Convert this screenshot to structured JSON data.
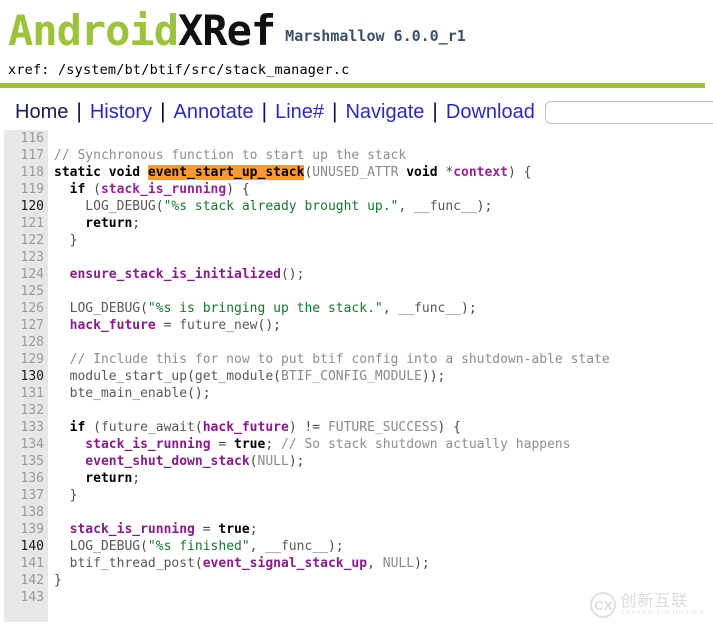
{
  "header": {
    "logo_android": "Android",
    "logo_xref": "XRef",
    "version": "Marshmallow 6.0.0_r1"
  },
  "breadcrumb": {
    "label": "xref:",
    "path": "/system/bt/btif/src/stack_manager.c",
    "full": "xref: /system/bt/btif/src/stack_manager.c"
  },
  "nav": {
    "items": [
      {
        "label": "Home",
        "current": true
      },
      {
        "label": "History",
        "current": false
      },
      {
        "label": "Annotate",
        "current": false
      },
      {
        "label": "Line#",
        "current": false
      },
      {
        "label": "Navigate",
        "current": false
      },
      {
        "label": "Download",
        "current": false
      }
    ],
    "separator": "|",
    "search": {
      "value": "",
      "placeholder": ""
    }
  },
  "colors": {
    "brand_green": "#9dc23c",
    "divider_green": "#9fc23c",
    "link_blue": "#2b2bbb",
    "highlight_orange": "#ff9933",
    "gutter_gray": "#e7e7e7",
    "string_green": "#15772f",
    "identifier_purple": "#8b1a8b",
    "comment_gray": "#8e8e8e",
    "version_blue": "#3b5068"
  },
  "code": {
    "highlighted_symbol": "event_start_up_stack",
    "first_line": 116,
    "last_line": 143,
    "lines": [
      {
        "n": "116",
        "tokens": []
      },
      {
        "n": "117",
        "tokens": [
          {
            "t": "comment",
            "s": "// Synchronous function to start up the stack"
          }
        ]
      },
      {
        "n": "118",
        "tokens": [
          {
            "t": "kw",
            "s": "static void "
          },
          {
            "t": "hl",
            "s": "event_start_up_stack"
          },
          {
            "t": "punc",
            "s": "("
          },
          {
            "t": "const",
            "s": "UNUSED_ATTR "
          },
          {
            "t": "kw",
            "s": "void "
          },
          {
            "t": "punc",
            "s": "*"
          },
          {
            "t": "idp",
            "s": "context"
          },
          {
            "t": "punc",
            "s": ") {"
          }
        ]
      },
      {
        "n": "119",
        "tokens": [
          {
            "t": "kw",
            "s": "  if "
          },
          {
            "t": "punc",
            "s": "("
          },
          {
            "t": "idp",
            "s": "stack_is_running"
          },
          {
            "t": "punc",
            "s": ") {"
          }
        ]
      },
      {
        "n": "120",
        "tokens": [
          {
            "t": "plain",
            "s": "    LOG_DEBUG"
          },
          {
            "t": "punc",
            "s": "("
          },
          {
            "t": "str",
            "s": "\"%s stack already brought up.\""
          },
          {
            "t": "punc",
            "s": ", "
          },
          {
            "t": "plain",
            "s": "__func__"
          },
          {
            "t": "punc",
            "s": ");"
          }
        ]
      },
      {
        "n": "121",
        "tokens": [
          {
            "t": "kw",
            "s": "    return"
          },
          {
            "t": "punc",
            "s": ";"
          }
        ]
      },
      {
        "n": "122",
        "tokens": [
          {
            "t": "punc",
            "s": "  }"
          }
        ]
      },
      {
        "n": "123",
        "tokens": []
      },
      {
        "n": "124",
        "tokens": [
          {
            "t": "id",
            "s": "  ensure_stack_is_initialized"
          },
          {
            "t": "punc",
            "s": "();"
          }
        ]
      },
      {
        "n": "125",
        "tokens": []
      },
      {
        "n": "126",
        "tokens": [
          {
            "t": "plain",
            "s": "  LOG_DEBUG"
          },
          {
            "t": "punc",
            "s": "("
          },
          {
            "t": "str",
            "s": "\"%s is bringing up the stack.\""
          },
          {
            "t": "punc",
            "s": ", "
          },
          {
            "t": "plain",
            "s": "__func__"
          },
          {
            "t": "punc",
            "s": ");"
          }
        ]
      },
      {
        "n": "127",
        "tokens": [
          {
            "t": "id",
            "s": "  hack_future"
          },
          {
            "t": "punc",
            "s": " = "
          },
          {
            "t": "plain",
            "s": "future_new"
          },
          {
            "t": "punc",
            "s": "();"
          }
        ]
      },
      {
        "n": "128",
        "tokens": []
      },
      {
        "n": "129",
        "tokens": [
          {
            "t": "comment",
            "s": "  // Include this for now to put btif config into a shutdown-able state"
          }
        ]
      },
      {
        "n": "130",
        "tokens": [
          {
            "t": "plain",
            "s": "  module_start_up"
          },
          {
            "t": "punc",
            "s": "("
          },
          {
            "t": "plain",
            "s": "get_module"
          },
          {
            "t": "punc",
            "s": "("
          },
          {
            "t": "const",
            "s": "BTIF_CONFIG_MODULE"
          },
          {
            "t": "punc",
            "s": "));"
          }
        ]
      },
      {
        "n": "131",
        "tokens": [
          {
            "t": "plain",
            "s": "  bte_main_enable"
          },
          {
            "t": "punc",
            "s": "();"
          }
        ]
      },
      {
        "n": "132",
        "tokens": []
      },
      {
        "n": "133",
        "tokens": [
          {
            "t": "kw",
            "s": "  if "
          },
          {
            "t": "punc",
            "s": "("
          },
          {
            "t": "plain",
            "s": "future_await"
          },
          {
            "t": "punc",
            "s": "("
          },
          {
            "t": "id",
            "s": "hack_future"
          },
          {
            "t": "punc",
            "s": ") != "
          },
          {
            "t": "const",
            "s": "FUTURE_SUCCESS"
          },
          {
            "t": "punc",
            "s": ") {"
          }
        ]
      },
      {
        "n": "134",
        "tokens": [
          {
            "t": "id",
            "s": "    stack_is_running"
          },
          {
            "t": "punc",
            "s": " = "
          },
          {
            "t": "kw",
            "s": "true"
          },
          {
            "t": "punc",
            "s": "; "
          },
          {
            "t": "comment",
            "s": "// So stack shutdown actually happens"
          }
        ]
      },
      {
        "n": "135",
        "tokens": [
          {
            "t": "id",
            "s": "    event_shut_down_stack"
          },
          {
            "t": "punc",
            "s": "("
          },
          {
            "t": "const",
            "s": "NULL"
          },
          {
            "t": "punc",
            "s": ");"
          }
        ]
      },
      {
        "n": "136",
        "tokens": [
          {
            "t": "kw",
            "s": "    return"
          },
          {
            "t": "punc",
            "s": ";"
          }
        ]
      },
      {
        "n": "137",
        "tokens": [
          {
            "t": "punc",
            "s": "  }"
          }
        ]
      },
      {
        "n": "138",
        "tokens": []
      },
      {
        "n": "139",
        "tokens": [
          {
            "t": "id",
            "s": "  stack_is_running"
          },
          {
            "t": "punc",
            "s": " = "
          },
          {
            "t": "kw",
            "s": "true"
          },
          {
            "t": "punc",
            "s": ";"
          }
        ]
      },
      {
        "n": "140",
        "tokens": [
          {
            "t": "plain",
            "s": "  LOG_DEBUG"
          },
          {
            "t": "punc",
            "s": "("
          },
          {
            "t": "str",
            "s": "\"%s finished\""
          },
          {
            "t": "punc",
            "s": ", "
          },
          {
            "t": "plain",
            "s": "__func__"
          },
          {
            "t": "punc",
            "s": ");"
          }
        ]
      },
      {
        "n": "141",
        "tokens": [
          {
            "t": "plain",
            "s": "  btif_thread_post"
          },
          {
            "t": "punc",
            "s": "("
          },
          {
            "t": "id",
            "s": "event_signal_stack_up"
          },
          {
            "t": "punc",
            "s": ", "
          },
          {
            "t": "const",
            "s": "NULL"
          },
          {
            "t": "punc",
            "s": ");"
          }
        ]
      },
      {
        "n": "142",
        "tokens": [
          {
            "t": "punc",
            "s": "}"
          }
        ]
      },
      {
        "n": "143",
        "tokens": []
      }
    ]
  },
  "watermark": {
    "mark": "CX",
    "chinese": "创新互联",
    "pinyin": "CHUANG XIN HU LIAN"
  }
}
